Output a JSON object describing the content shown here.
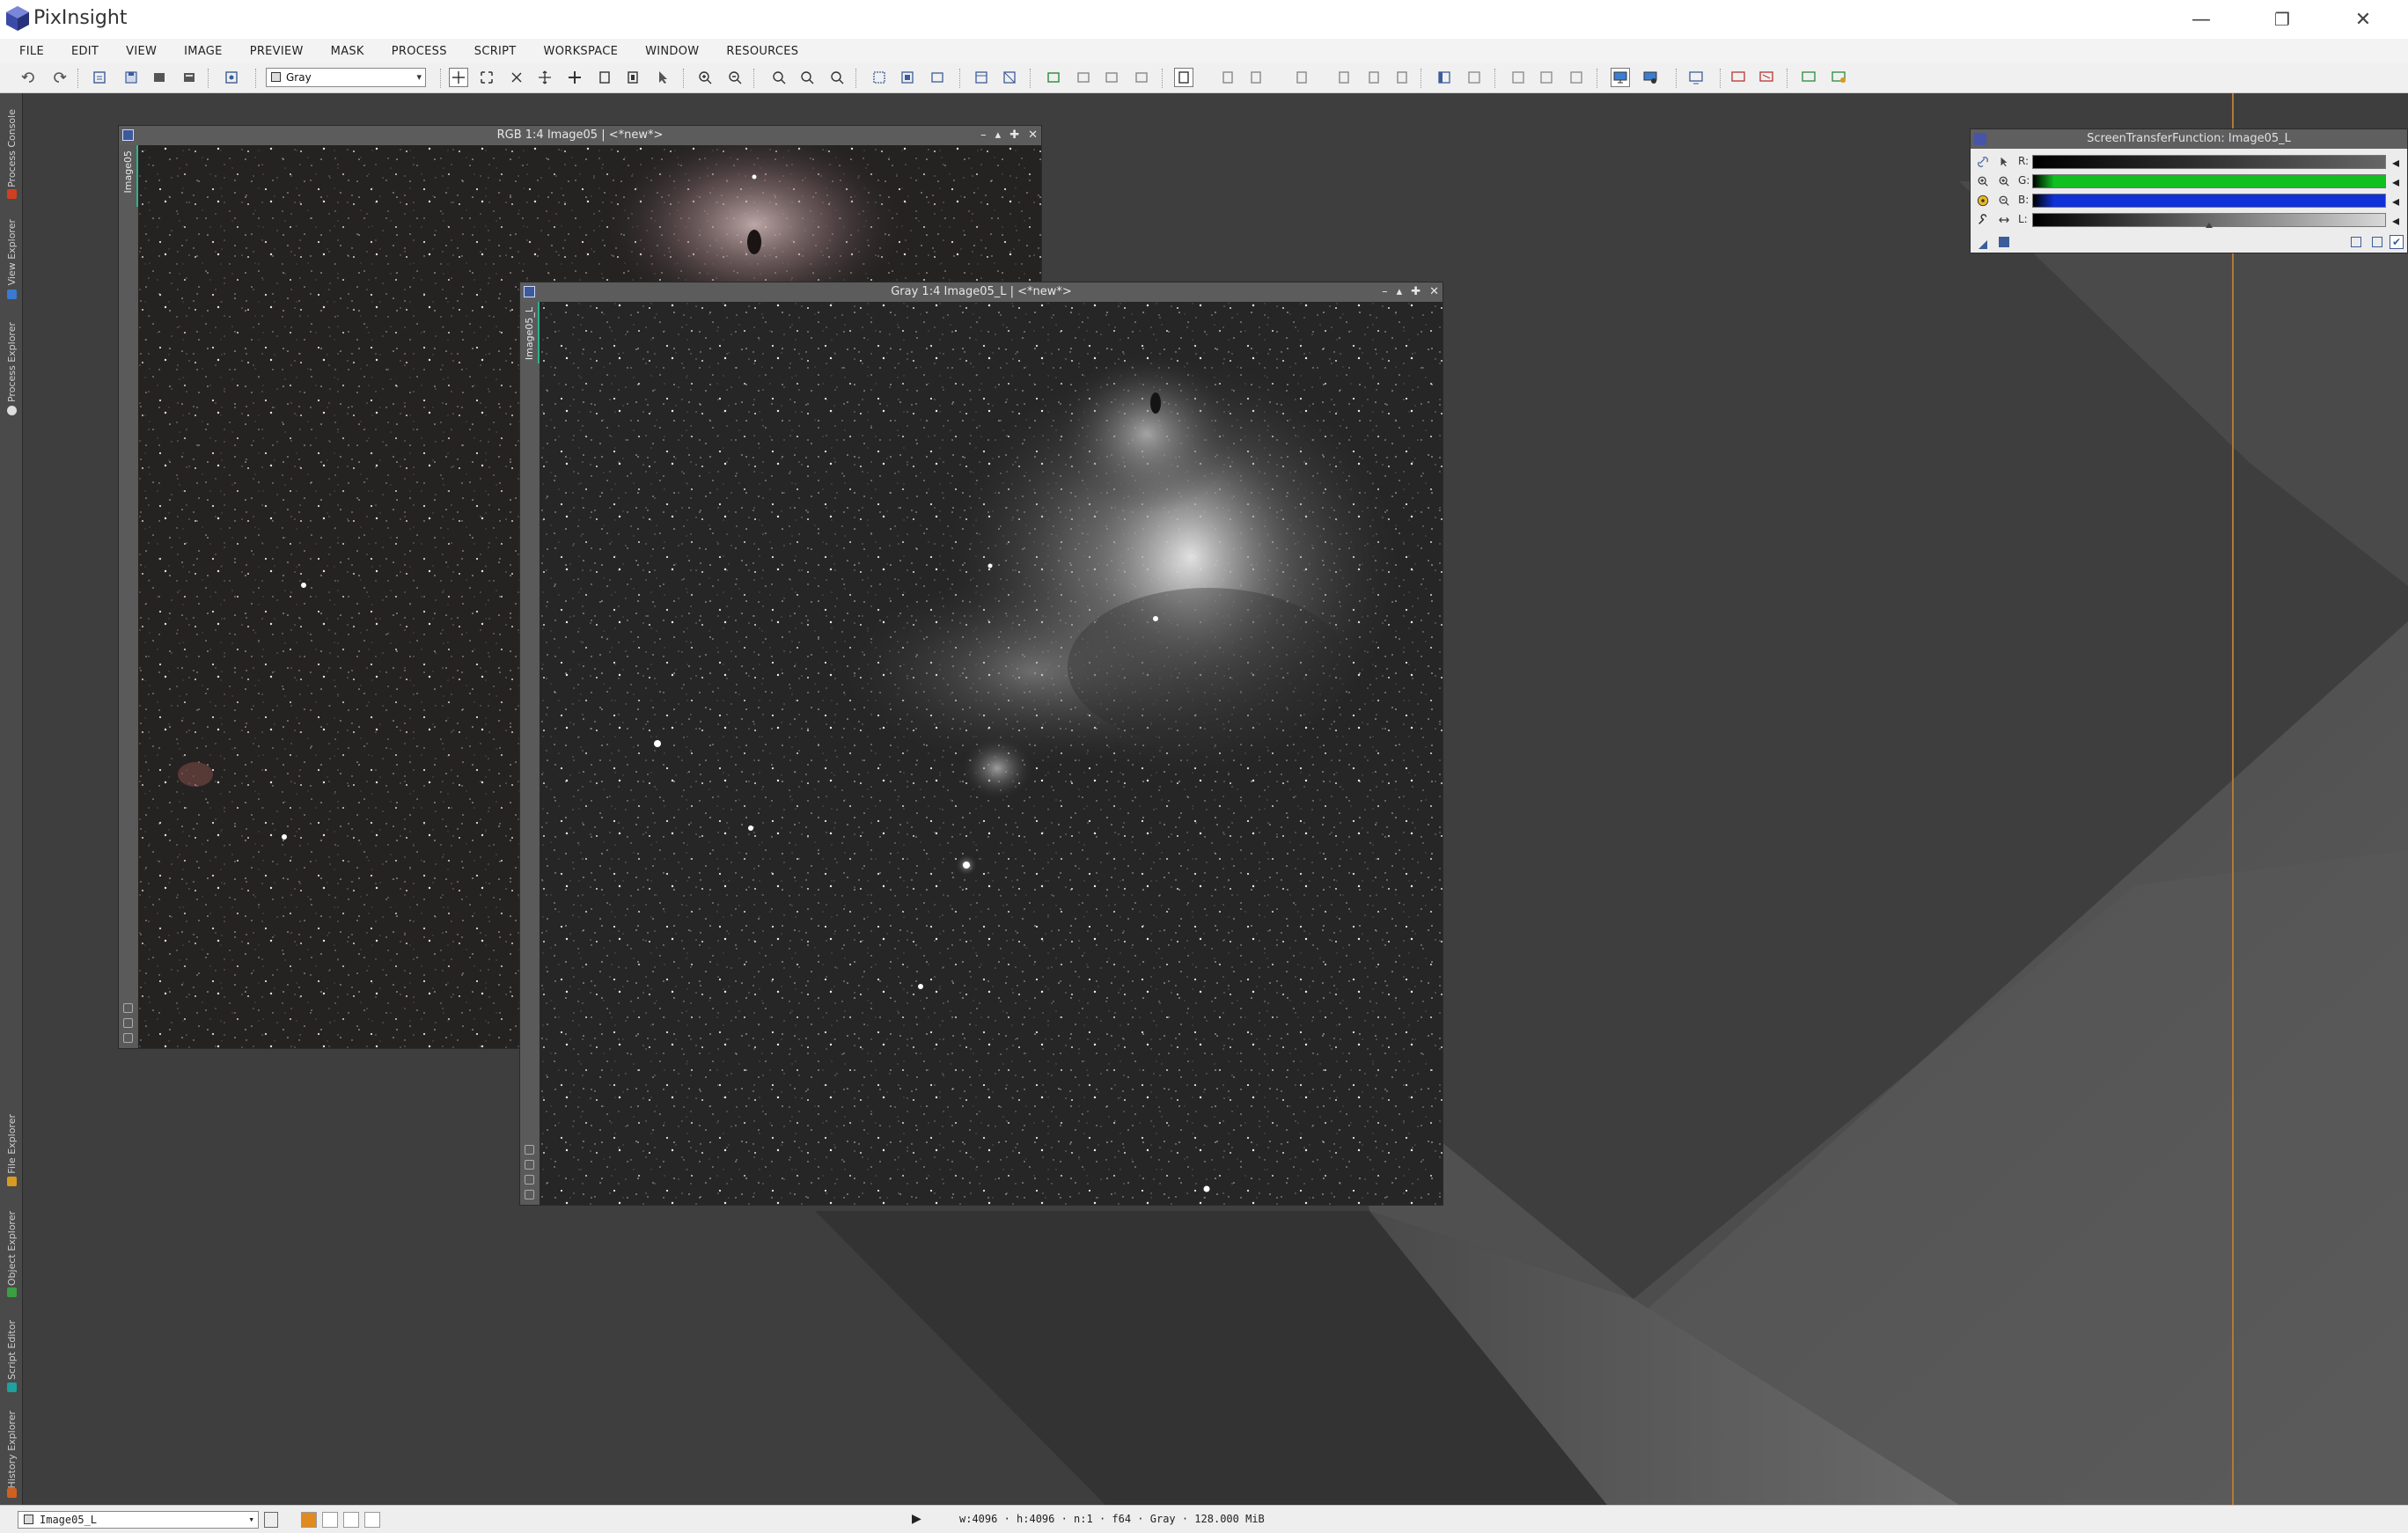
{
  "app": {
    "title": "PixInsight"
  },
  "window_controls": {
    "minimize": "—",
    "restore": "❐",
    "close": "✕"
  },
  "menu": [
    "FILE",
    "EDIT",
    "VIEW",
    "IMAGE",
    "PREVIEW",
    "MASK",
    "PROCESS",
    "SCRIPT",
    "WORKSPACE",
    "WINDOW",
    "RESOURCES"
  ],
  "toolbar": {
    "color_space_combo": "Gray"
  },
  "left_dock": {
    "tabs_top": [
      "Process Console",
      "View Explorer",
      "Process Explorer"
    ],
    "tabs_bottom": [
      "File Explorer",
      "Object Explorer",
      "Script Editor",
      "History Explorer"
    ]
  },
  "windows": [
    {
      "title": "RGB 1:4 Image05 | <*new*>",
      "side_label": "Image05"
    },
    {
      "title": "Gray 1:4 Image05_L | <*new*>",
      "side_label": "Image05_L"
    }
  ],
  "stf_panel": {
    "title": "ScreenTransferFunction: Image05_L",
    "rows": [
      {
        "label": "R:",
        "color": "#111111"
      },
      {
        "label": "G:",
        "color": "#10c020"
      },
      {
        "label": "B:",
        "color": "#1030d8"
      },
      {
        "label": "L:",
        "color": "#808080"
      }
    ]
  },
  "statusbar": {
    "view_selector": "Image05_L",
    "info": "w:4096 · h:4096 · n:1 · f64 · Gray · 128.000 MiB"
  },
  "colors": {
    "accent_strip": "#2db38b",
    "workspace": "#3e3e3e"
  }
}
